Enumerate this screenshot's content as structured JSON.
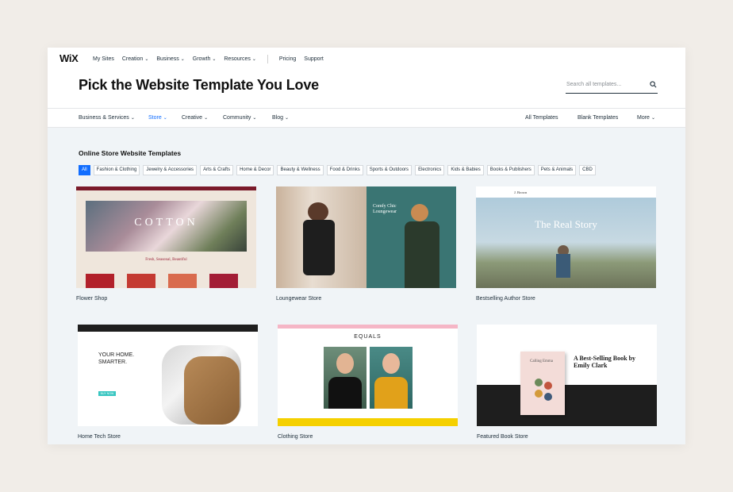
{
  "brand": "WiX",
  "topnav": {
    "items": [
      {
        "label": "My Sites",
        "dropdown": false
      },
      {
        "label": "Creation",
        "dropdown": true
      },
      {
        "label": "Business",
        "dropdown": true
      },
      {
        "label": "Growth",
        "dropdown": true
      },
      {
        "label": "Resources",
        "dropdown": true
      },
      {
        "label": "Pricing",
        "dropdown": false
      },
      {
        "label": "Support",
        "dropdown": false
      }
    ]
  },
  "page_title": "Pick the Website Template You Love",
  "search": {
    "placeholder": "Search all templates..."
  },
  "categories": {
    "left": [
      {
        "label": "Business & Services",
        "active": false
      },
      {
        "label": "Store",
        "active": true
      },
      {
        "label": "Creative",
        "active": false
      },
      {
        "label": "Community",
        "active": false
      },
      {
        "label": "Blog",
        "active": false
      }
    ],
    "right": [
      {
        "label": "All Templates"
      },
      {
        "label": "Blank Templates"
      },
      {
        "label": "More"
      }
    ]
  },
  "section_title": "Online Store Website Templates",
  "subcategories": [
    "All",
    "Fashion & Clothing",
    "Jewelry & Accessories",
    "Arts & Crafts",
    "Home & Decor",
    "Beauty & Wellness",
    "Food & Drinks",
    "Sports & Outdoors",
    "Electronics",
    "Kids & Babies",
    "Books & Publishers",
    "Pets & Animals",
    "CBD"
  ],
  "active_subcategory": "All",
  "templates": [
    {
      "name": "Flower Shop",
      "hero_text": "COTTON",
      "tagline": "Fresh, Seasonal, Beautiful"
    },
    {
      "name": "Loungewear Store",
      "hero_text": "Comfy Chic Loungewear"
    },
    {
      "name": "Bestselling Author Store",
      "hero_text": "The Real Story",
      "brand": "J. Brown"
    },
    {
      "name": "Home Tech Store",
      "hero_text": "YOUR HOME. SMARTER.",
      "cta": "BUY NOW"
    },
    {
      "name": "Clothing Store",
      "hero_text": "EQUALS"
    },
    {
      "name": "Featured Book Store",
      "hero_text": "A Best-Selling Book by Emily Clark",
      "book_title": "Calling Emma"
    }
  ],
  "colors": {
    "accent": "#116dff",
    "page_bg": "#f1ede8",
    "content_bg": "#f0f4f7"
  }
}
